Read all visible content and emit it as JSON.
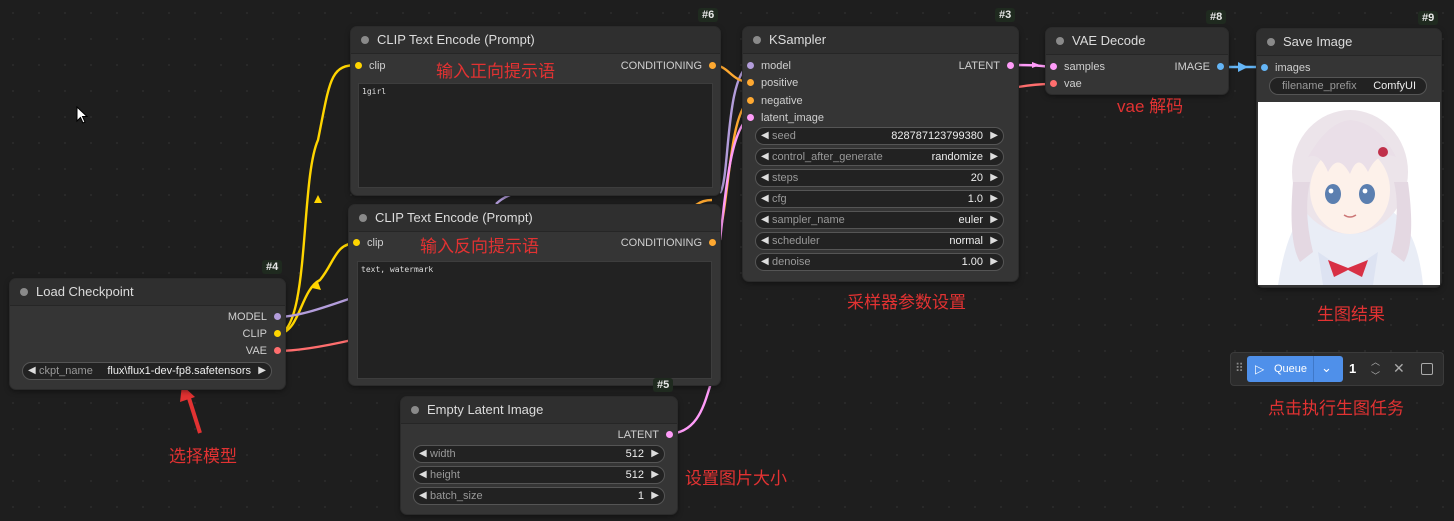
{
  "nodes": {
    "clip_pos": {
      "id": "#6",
      "title": "CLIP Text Encode (Prompt)",
      "input": "clip",
      "output": "CONDITIONING",
      "text": "1girl"
    },
    "clip_neg": {
      "id": "",
      "title": "CLIP Text Encode (Prompt)",
      "input": "clip",
      "output": "CONDITIONING",
      "text": "text, watermark"
    },
    "ksampler": {
      "id": "#3",
      "title": "KSampler",
      "inputs": [
        "model",
        "positive",
        "negative",
        "latent_image"
      ],
      "output": "LATENT",
      "widgets": [
        {
          "label": "seed",
          "value": "828787123799380"
        },
        {
          "label": "control_after_generate",
          "value": "randomize"
        },
        {
          "label": "steps",
          "value": "20"
        },
        {
          "label": "cfg",
          "value": "1.0"
        },
        {
          "label": "sampler_name",
          "value": "euler"
        },
        {
          "label": "scheduler",
          "value": "normal"
        },
        {
          "label": "denoise",
          "value": "1.00"
        }
      ]
    },
    "vae_decode": {
      "id": "#8",
      "title": "VAE Decode",
      "inputs": [
        "samples",
        "vae"
      ],
      "output": "IMAGE"
    },
    "save_image": {
      "id": "#9",
      "title": "Save Image",
      "input": "images",
      "widget": {
        "label": "filename_prefix",
        "value": "ComfyUI"
      }
    },
    "checkpoint": {
      "id": "#4",
      "title": "Load Checkpoint",
      "outputs": [
        "MODEL",
        "CLIP",
        "VAE"
      ],
      "widget": {
        "label": "ckpt_name",
        "value": "flux\\flux1-dev-fp8.safetensors"
      }
    },
    "latent": {
      "id": "#5",
      "title": "Empty Latent Image",
      "output": "LATENT",
      "widgets": [
        {
          "label": "width",
          "value": "512"
        },
        {
          "label": "height",
          "value": "512"
        },
        {
          "label": "batch_size",
          "value": "1"
        }
      ]
    }
  },
  "annotations": {
    "positive": "输入正向提示语",
    "negative": "输入反向提示语",
    "vae": "vae 解码",
    "sampler": "采样器参数设置",
    "result": "生图结果",
    "model": "选择模型",
    "size": "设置图片大小",
    "queue": "点击执行生图任务"
  },
  "queue": {
    "label": "Queue",
    "count": "1"
  },
  "colors": {
    "model": "#b39ddb",
    "clip": "#ffd500",
    "vae": "#ff6e6e",
    "conditioning": "#ffa931",
    "latent": "#ff9cf9",
    "image": "#64b5f6",
    "annotation": "#e23232"
  }
}
